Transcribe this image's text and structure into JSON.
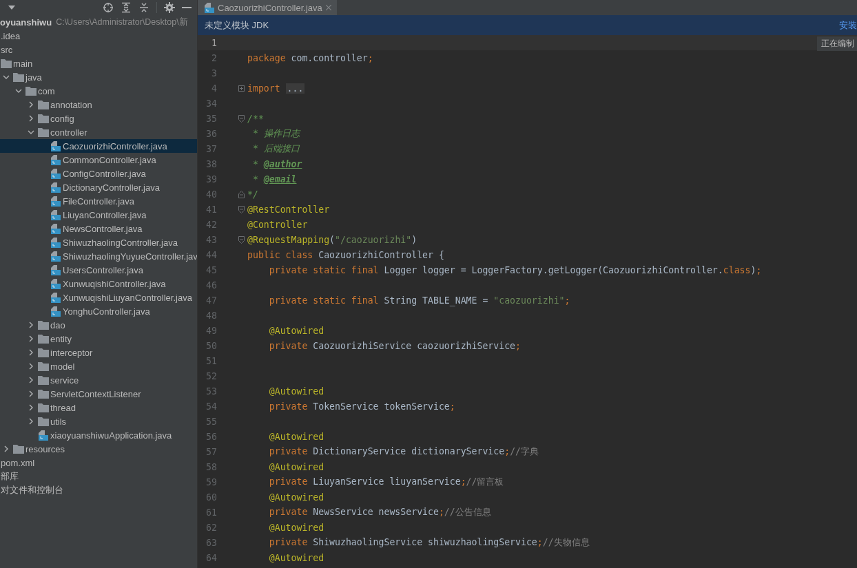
{
  "project": {
    "name": "oyuanshiwu",
    "path": "C:\\Users\\Administrator\\Desktop\\新"
  },
  "tree": [
    {
      "label": ".idea",
      "selected": false
    },
    {
      "label": "src",
      "selected": false,
      "children": [
        {
          "label": "main",
          "kind": "folder",
          "selected": false,
          "children": [
            {
              "label": "java",
              "kind": "folder",
              "expanded": true,
              "selected": false,
              "children": [
                {
                  "label": "com",
                  "kind": "folder",
                  "expanded": true,
                  "selected": false,
                  "children": [
                    {
                      "label": "annotation",
                      "kind": "folder",
                      "expanded": false,
                      "selected": false
                    },
                    {
                      "label": "config",
                      "kind": "folder",
                      "expanded": false,
                      "selected": false
                    },
                    {
                      "label": "controller",
                      "kind": "folder",
                      "expanded": true,
                      "selected": false,
                      "children": [
                        {
                          "label": "CaozuorizhiController.java",
                          "kind": "java",
                          "selected": true
                        },
                        {
                          "label": "CommonController.java",
                          "kind": "java",
                          "selected": false
                        },
                        {
                          "label": "ConfigController.java",
                          "kind": "java",
                          "selected": false
                        },
                        {
                          "label": "DictionaryController.java",
                          "kind": "java",
                          "selected": false
                        },
                        {
                          "label": "FileController.java",
                          "kind": "java",
                          "selected": false
                        },
                        {
                          "label": "LiuyanController.java",
                          "kind": "java",
                          "selected": false
                        },
                        {
                          "label": "NewsController.java",
                          "kind": "java",
                          "selected": false
                        },
                        {
                          "label": "ShiwuzhaolingController.java",
                          "kind": "java",
                          "selected": false
                        },
                        {
                          "label": "ShiwuzhaolingYuyueController.jav",
                          "kind": "java",
                          "selected": false
                        },
                        {
                          "label": "UsersController.java",
                          "kind": "java",
                          "selected": false
                        },
                        {
                          "label": "XunwuqishiController.java",
                          "kind": "java",
                          "selected": false
                        },
                        {
                          "label": "XunwuqishiLiuyanController.java",
                          "kind": "java",
                          "selected": false
                        },
                        {
                          "label": "YonghuController.java",
                          "kind": "java",
                          "selected": false
                        }
                      ]
                    },
                    {
                      "label": "dao",
                      "kind": "folder",
                      "expanded": false,
                      "selected": false
                    },
                    {
                      "label": "entity",
                      "kind": "folder",
                      "expanded": false,
                      "selected": false
                    },
                    {
                      "label": "interceptor",
                      "kind": "folder",
                      "expanded": false,
                      "selected": false
                    },
                    {
                      "label": "model",
                      "kind": "folder",
                      "expanded": false,
                      "selected": false
                    },
                    {
                      "label": "service",
                      "kind": "folder",
                      "expanded": false,
                      "selected": false
                    },
                    {
                      "label": "ServletContextListener",
                      "kind": "folder",
                      "expanded": false,
                      "selected": false
                    },
                    {
                      "label": "thread",
                      "kind": "folder",
                      "expanded": false,
                      "selected": false
                    },
                    {
                      "label": "utils",
                      "kind": "folder",
                      "expanded": false,
                      "selected": false
                    },
                    {
                      "label": "xiaoyuanshiwuApplication.java",
                      "kind": "java",
                      "selected": false
                    }
                  ]
                }
              ]
            },
            {
              "label": "resources",
              "kind": "folder",
              "expanded": false,
              "selected": false
            }
          ]
        }
      ]
    },
    {
      "label": "pom.xml",
      "selected": false
    },
    {
      "label": "部库",
      "selected": false
    },
    {
      "label": "对文件和控制台",
      "selected": false
    }
  ],
  "tab": {
    "label": "CaozuorizhiController.java",
    "selected": true
  },
  "notice": {
    "text": "未定义模块 JDK",
    "link": "安装"
  },
  "tooltip": "正在编制",
  "lines": [
    {
      "n": "1",
      "current": true,
      "kind": "plain"
    },
    {
      "n": "2",
      "current": false,
      "kind": "plain",
      "tokens": [
        {
          "kind": "keyword",
          "text": "package "
        },
        {
          "kind": "plain",
          "text": "com.controller"
        },
        {
          "kind": "keyword",
          "text": ";"
        }
      ]
    },
    {
      "n": "3",
      "current": false,
      "kind": "plain"
    },
    {
      "n": "4",
      "current": false,
      "kind": "collapsed",
      "tokens": [
        {
          "kind": "keyword",
          "text": "import "
        },
        {
          "kind": "folded",
          "text": "..."
        }
      ]
    },
    {
      "n": "34",
      "current": false,
      "kind": "plain"
    },
    {
      "n": "35",
      "current": false,
      "kind": "opener",
      "tokens": [
        {
          "kind": "doc",
          "text": "/**"
        }
      ]
    },
    {
      "n": "36",
      "current": false,
      "kind": "plain",
      "tokens": [
        {
          "kind": "doc",
          "text": " * 操作日志"
        }
      ]
    },
    {
      "n": "37",
      "current": false,
      "kind": "plain",
      "tokens": [
        {
          "kind": "doc",
          "text": " * 后端接口"
        }
      ]
    },
    {
      "n": "38",
      "current": false,
      "kind": "plain",
      "tokens": [
        {
          "kind": "doc",
          "text": " * "
        },
        {
          "kind": "doctag",
          "text": "@author"
        }
      ]
    },
    {
      "n": "39",
      "current": false,
      "kind": "plain",
      "tokens": [
        {
          "kind": "doc",
          "text": " * "
        },
        {
          "kind": "doctag",
          "text": "@email"
        }
      ]
    },
    {
      "n": "40",
      "current": false,
      "kind": "closer",
      "tokens": [
        {
          "kind": "doc",
          "text": "*/"
        }
      ]
    },
    {
      "n": "41",
      "current": false,
      "kind": "opener",
      "tokens": [
        {
          "kind": "annotation",
          "text": "@RestController"
        }
      ]
    },
    {
      "n": "42",
      "current": false,
      "kind": "plain",
      "tokens": [
        {
          "kind": "annotation",
          "text": "@Controller"
        }
      ]
    },
    {
      "n": "43",
      "current": false,
      "kind": "opener",
      "tokens": [
        {
          "kind": "annotation",
          "text": "@RequestMapping"
        },
        {
          "kind": "plain",
          "text": "("
        },
        {
          "kind": "string",
          "text": "\"/caozuorizhi\""
        },
        {
          "kind": "plain",
          "text": ")"
        }
      ]
    },
    {
      "n": "44",
      "current": false,
      "kind": "plain",
      "tokens": [
        {
          "kind": "keyword",
          "text": "public class "
        },
        {
          "kind": "plain",
          "text": "CaozuorizhiController {"
        }
      ]
    },
    {
      "n": "45",
      "current": false,
      "kind": "plain",
      "tokens": [
        {
          "kind": "keyword",
          "text": "    private static final "
        },
        {
          "kind": "plain",
          "text": "Logger logger = LoggerFactory.getLogger(CaozuorizhiController."
        },
        {
          "kind": "keyword",
          "text": "class"
        },
        {
          "kind": "plain",
          "text": ")"
        },
        {
          "kind": "keyword",
          "text": ";"
        }
      ]
    },
    {
      "n": "46",
      "current": false,
      "kind": "plain"
    },
    {
      "n": "47",
      "current": false,
      "kind": "plain",
      "tokens": [
        {
          "kind": "keyword",
          "text": "    private static final "
        },
        {
          "kind": "plain",
          "text": "String TABLE_NAME = "
        },
        {
          "kind": "string",
          "text": "\"caozuorizhi\""
        },
        {
          "kind": "keyword",
          "text": ";"
        }
      ]
    },
    {
      "n": "48",
      "current": false,
      "kind": "plain"
    },
    {
      "n": "49",
      "current": false,
      "kind": "plain",
      "tokens": [
        {
          "kind": "annotation",
          "text": "    @Autowired"
        }
      ]
    },
    {
      "n": "50",
      "current": false,
      "kind": "plain",
      "tokens": [
        {
          "kind": "keyword",
          "text": "    private "
        },
        {
          "kind": "plain",
          "text": "CaozuorizhiService caozuorizhiService"
        },
        {
          "kind": "keyword",
          "text": ";"
        }
      ]
    },
    {
      "n": "51",
      "current": false,
      "kind": "plain"
    },
    {
      "n": "52",
      "current": false,
      "kind": "plain"
    },
    {
      "n": "53",
      "current": false,
      "kind": "plain",
      "tokens": [
        {
          "kind": "annotation",
          "text": "    @Autowired"
        }
      ]
    },
    {
      "n": "54",
      "current": false,
      "kind": "plain",
      "tokens": [
        {
          "kind": "keyword",
          "text": "    private "
        },
        {
          "kind": "plain",
          "text": "TokenService tokenService"
        },
        {
          "kind": "keyword",
          "text": ";"
        }
      ]
    },
    {
      "n": "55",
      "current": false,
      "kind": "plain"
    },
    {
      "n": "56",
      "current": false,
      "kind": "plain",
      "tokens": [
        {
          "kind": "annotation",
          "text": "    @Autowired"
        }
      ]
    },
    {
      "n": "57",
      "current": false,
      "kind": "plain",
      "tokens": [
        {
          "kind": "keyword",
          "text": "    private "
        },
        {
          "kind": "plain",
          "text": "DictionaryService dictionaryService"
        },
        {
          "kind": "keyword",
          "text": ";"
        },
        {
          "kind": "comment",
          "text": "//字典"
        }
      ]
    },
    {
      "n": "58",
      "current": false,
      "kind": "plain",
      "tokens": [
        {
          "kind": "annotation",
          "text": "    @Autowired"
        }
      ]
    },
    {
      "n": "59",
      "current": false,
      "kind": "plain",
      "tokens": [
        {
          "kind": "keyword",
          "text": "    private "
        },
        {
          "kind": "plain",
          "text": "LiuyanService liuyanService"
        },
        {
          "kind": "keyword",
          "text": ";"
        },
        {
          "kind": "comment",
          "text": "//留言板"
        }
      ]
    },
    {
      "n": "60",
      "current": false,
      "kind": "plain",
      "tokens": [
        {
          "kind": "annotation",
          "text": "    @Autowired"
        }
      ]
    },
    {
      "n": "61",
      "current": false,
      "kind": "plain",
      "tokens": [
        {
          "kind": "keyword",
          "text": "    private "
        },
        {
          "kind": "plain",
          "text": "NewsService newsService"
        },
        {
          "kind": "keyword",
          "text": ";"
        },
        {
          "kind": "comment",
          "text": "//公告信息"
        }
      ]
    },
    {
      "n": "62",
      "current": false,
      "kind": "plain",
      "tokens": [
        {
          "kind": "annotation",
          "text": "    @Autowired"
        }
      ]
    },
    {
      "n": "63",
      "current": false,
      "kind": "plain",
      "tokens": [
        {
          "kind": "keyword",
          "text": "    private "
        },
        {
          "kind": "plain",
          "text": "ShiwuzhaolingService shiwuzhaolingService"
        },
        {
          "kind": "keyword",
          "text": ";"
        },
        {
          "kind": "comment",
          "text": "//失物信息"
        }
      ]
    },
    {
      "n": "64",
      "current": false,
      "kind": "plain",
      "tokens": [
        {
          "kind": "annotation",
          "text": "    @Autowired"
        }
      ]
    }
  ]
}
